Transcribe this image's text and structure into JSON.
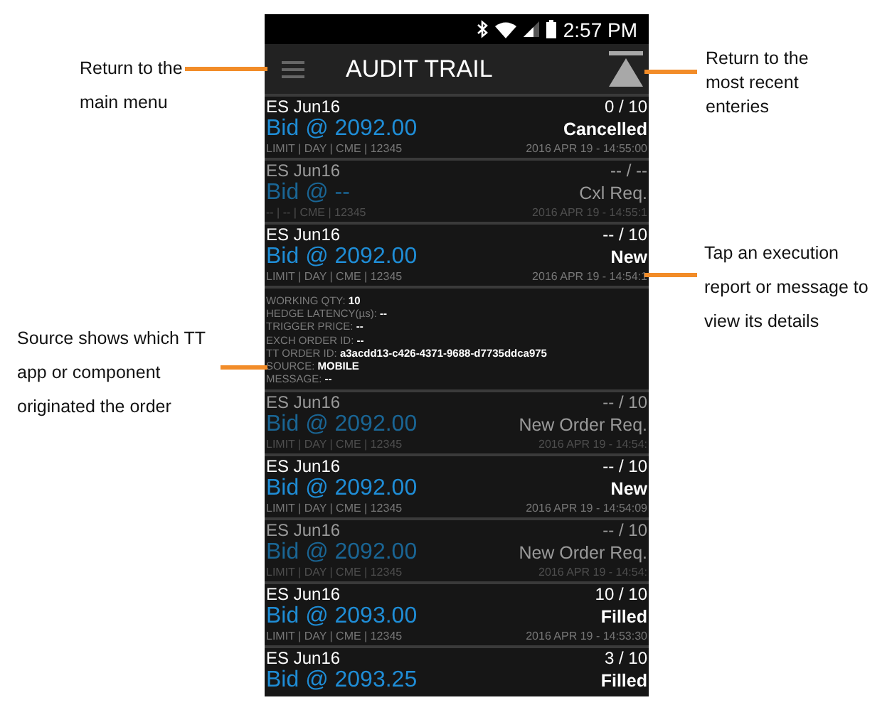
{
  "annotations": [
    {
      "text": "Return to the main menu"
    },
    {
      "text": "Source shows which TT app or component originated the order"
    },
    {
      "text": "Return to the most recent enteries"
    },
    {
      "text": "Tap an execution report or message to view its details"
    }
  ],
  "status_bar": {
    "time": "2:57 PM"
  },
  "header": {
    "title": "AUDIT TRAIL"
  },
  "entries": [
    {
      "instrument": "ES Jun16",
      "price": "Bid @ 2092.00",
      "details": "LIMIT | DAY | CME | 12345",
      "quantity": "0 / 10",
      "status": "Cancelled",
      "timestamp": "2016 APR 19 - 14:55:00",
      "dimmed": false
    },
    {
      "instrument": "ES Jun16",
      "price": "Bid @ --",
      "details": "-- | -- | CME | 12345",
      "quantity": "-- / --",
      "status": "Cxl Req.",
      "timestamp": "2016 APR 19 - 14:55:1",
      "dimmed": true
    },
    {
      "instrument": "ES Jun16",
      "price": "Bid @ 2092.00",
      "details": "LIMIT | DAY | CME | 12345",
      "quantity": "-- / 10",
      "status": "New",
      "timestamp": "2016 APR 19 - 14:54:1",
      "dimmed": false,
      "detail_lines": [
        "WORKING QTY: **10**",
        "HEDGE LATENCY(µs): **--**",
        "TRIGGER PRICE: **--**",
        "EXCH ORDER ID: **--**",
        "TT ORDER ID: **a3acdd13-c426-4371-9688-d7735ddca975**",
        "SOURCE: **MOBILE**",
        "MESSAGE: **--**"
      ]
    },
    {
      "instrument": "ES Jun16",
      "price": "Bid @ 2092.00",
      "details": "LIMIT | DAY | CME | 12345",
      "quantity": "-- / 10",
      "status": "New Order Req.",
      "timestamp": "2016 APR 19 - 14:54:",
      "dimmed": true
    },
    {
      "instrument": "ES Jun16",
      "price": "Bid @ 2092.00",
      "details": "LIMIT | DAY | CME | 12345",
      "quantity": "-- / 10",
      "status": "New",
      "timestamp": "2016 APR 19 - 14:54:09",
      "dimmed": false
    },
    {
      "instrument": "ES Jun16",
      "price": "Bid @ 2092.00",
      "details": "LIMIT | DAY | CME | 12345",
      "quantity": "-- / 10",
      "status": "New Order Req.",
      "timestamp": "2016 APR 19 - 14:54:",
      "dimmed": true
    },
    {
      "instrument": "ES Jun16",
      "price": "Bid @ 2093.00",
      "details": "LIMIT | DAY | CME | 12345",
      "quantity": "10 / 10",
      "status": "Filled",
      "timestamp": "2016 APR 19 - 14:53:30",
      "dimmed": false
    },
    {
      "instrument": "ES Jun16",
      "price": "Bid @ 2093.25",
      "quantity": "3 / 10",
      "status": "Filled",
      "dimmed": false
    }
  ]
}
